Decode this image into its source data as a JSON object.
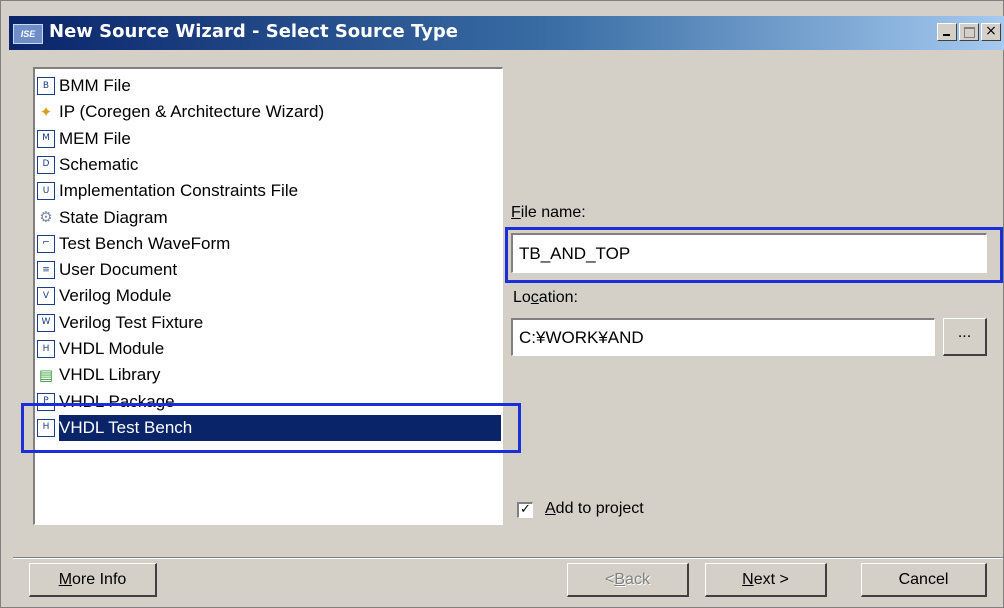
{
  "window": {
    "app_icon_text": "ISE",
    "title": "New Source Wizard - Select Source Type",
    "min_glyph": "",
    "max_glyph": "",
    "close_glyph": "×"
  },
  "source_types": [
    {
      "label": "BMM File",
      "icon": "bmm-file-icon",
      "glyph": "B"
    },
    {
      "label": "IP (Coregen & Architecture Wizard)",
      "icon": "ip-wizard-icon",
      "glyph": "✦"
    },
    {
      "label": "MEM File",
      "icon": "mem-file-icon",
      "glyph": "M"
    },
    {
      "label": "Schematic",
      "icon": "schematic-icon",
      "glyph": "D"
    },
    {
      "label": "Implementation Constraints File",
      "icon": "constraints-file-icon",
      "glyph": "U"
    },
    {
      "label": "State Diagram",
      "icon": "state-diagram-icon",
      "glyph": "⚙"
    },
    {
      "label": "Test Bench WaveForm",
      "icon": "waveform-icon",
      "glyph": "⌐"
    },
    {
      "label": "User Document",
      "icon": "user-document-icon",
      "glyph": "≡"
    },
    {
      "label": "Verilog Module",
      "icon": "verilog-module-icon",
      "glyph": "V"
    },
    {
      "label": "Verilog Test Fixture",
      "icon": "verilog-fixture-icon",
      "glyph": "W"
    },
    {
      "label": "VHDL Module",
      "icon": "vhdl-module-icon",
      "glyph": "H"
    },
    {
      "label": "VHDL Library",
      "icon": "vhdl-library-icon",
      "glyph": "▤"
    },
    {
      "label": "VHDL Package",
      "icon": "vhdl-package-icon",
      "glyph": "P"
    },
    {
      "label": "VHDL Test Bench",
      "icon": "vhdl-testbench-icon",
      "glyph": "H"
    }
  ],
  "selected_index": 13,
  "file_name": {
    "label": "File name:",
    "value": "TB_AND_TOP"
  },
  "location": {
    "label": "Location:",
    "value": "C:¥WORK¥AND",
    "browse_label": "..."
  },
  "add_to_project": {
    "label": "Add to project",
    "checked": true,
    "check_glyph": "✓"
  },
  "buttons": {
    "more_info": "More Info",
    "back": "< Back",
    "next": "Next >",
    "cancel": "Cancel"
  },
  "colors": {
    "highlight_box": "#1a2fd8",
    "selection": "#0a246a",
    "title_bar": "#0a246a"
  }
}
